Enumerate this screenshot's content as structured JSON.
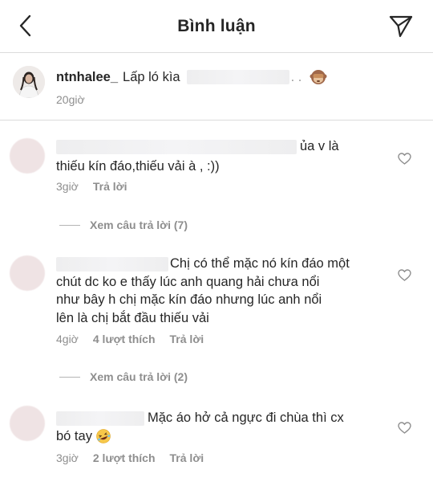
{
  "header": {
    "title": "Bình luận"
  },
  "caption": {
    "username": "ntnhalee_",
    "text": "Lấp ló kìa",
    "dots": ". .",
    "time": "20giờ"
  },
  "comments": [
    {
      "text_line1_suffix": "ủa v là",
      "text_line2": "thiếu kín đáo,thiếu vải à , :))",
      "time": "3giờ",
      "reply": "Trả lời",
      "view_replies": "Xem câu trả lời (7)"
    },
    {
      "text_line1_suffix": "Chị có thể mặc nó kín đáo một",
      "text_line2": "chút dc ko e thấy lúc anh quang hải chưa nổi",
      "text_line3": "như bây h chị mặc kín đáo nhưng lúc anh nổi",
      "text_line4": "lên là chị bắt đầu thiếu vải",
      "time": "4giờ",
      "likes": "4 lượt thích",
      "reply": "Trả lời",
      "view_replies": "Xem câu trả lời (2)"
    },
    {
      "text_line1_suffix": "Mặc áo hở cả ngực đi chùa thì cx",
      "text_line2": "bó tay",
      "time": "3giờ",
      "likes": "2 lượt thích",
      "reply": "Trả lời"
    }
  ],
  "icons": {
    "back": "chevron-left-icon",
    "send": "paper-plane-icon",
    "like": "heart-outline-icon",
    "caption_emoji": "see-no-evil-monkey-icon",
    "comment_emoji": "rolling-on-floor-laughing-icon"
  },
  "colors": {
    "text": "#262626",
    "muted": "#8e8e8e",
    "divider": "#dbdbdb"
  }
}
